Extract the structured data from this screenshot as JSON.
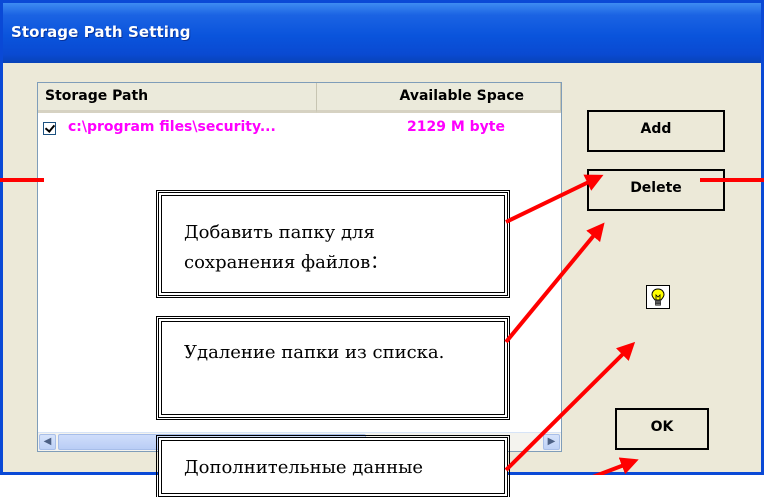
{
  "window": {
    "title": "Storage Path Setting",
    "title_bar_color": "#0a54dc",
    "face_color": "#ece9d8"
  },
  "list": {
    "columns": [
      "Storage Path",
      "Available Space"
    ],
    "rows": [
      {
        "checked": true,
        "path": "c:\\program files\\security...",
        "space": "2129 M byte"
      }
    ],
    "row_text_color": "#ff00ff"
  },
  "buttons": {
    "add": "Add",
    "delete": "Delete",
    "ok": "OK"
  },
  "icons": {
    "hint": "lightbulb-icon"
  },
  "callouts": {
    "add_folder_line1": "Добавить папку для",
    "add_folder_line2": "сохранения файлов：",
    "delete_folder": "Удаление папки из списка.",
    "extra": "Дополнительные данные"
  },
  "annotation_color": "#ff0000"
}
